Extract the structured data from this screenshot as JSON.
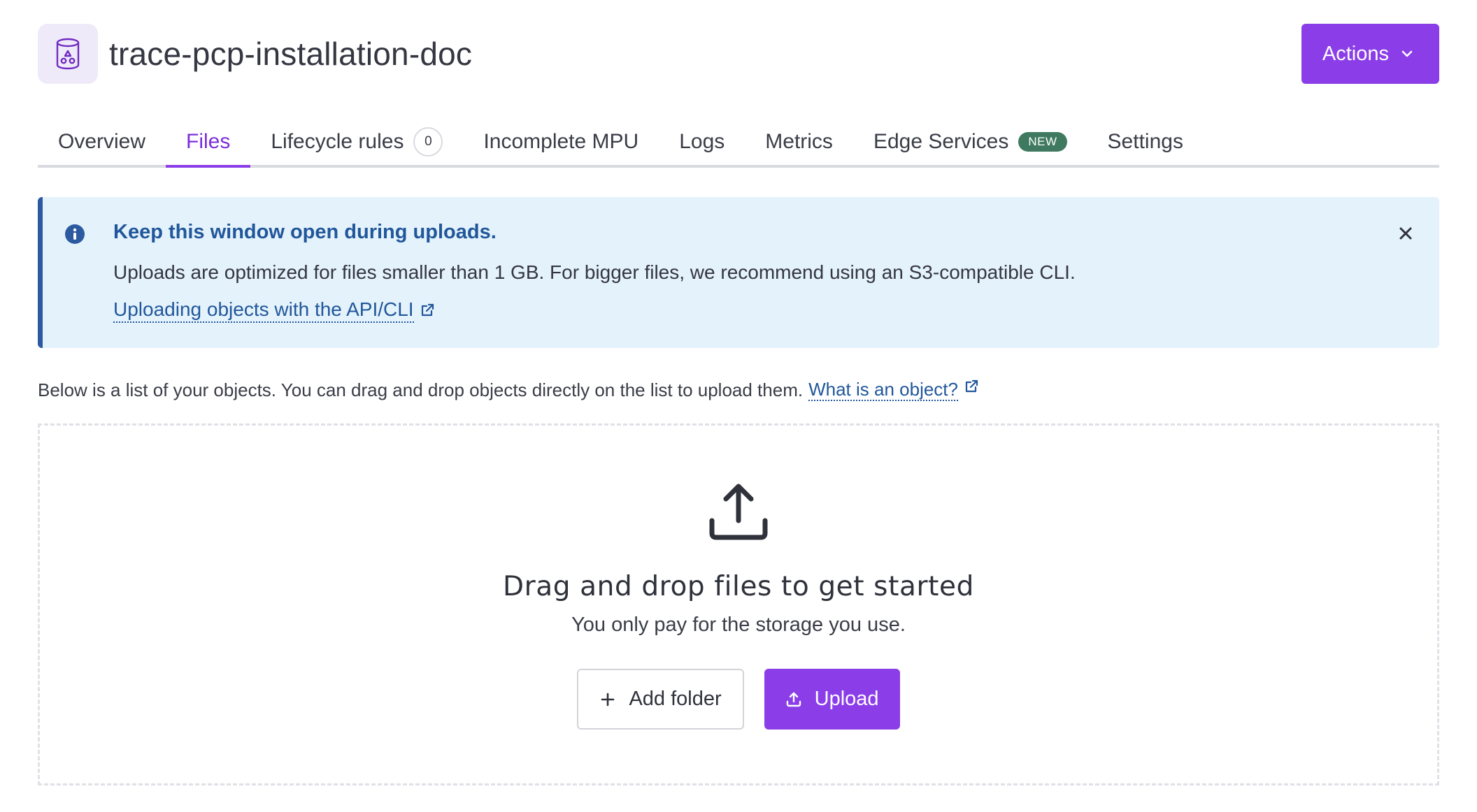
{
  "header": {
    "title": "trace-pcp-installation-doc",
    "actions_label": "Actions"
  },
  "tabs": [
    {
      "label": "Overview",
      "active": false
    },
    {
      "label": "Files",
      "active": true
    },
    {
      "label": "Lifecycle rules",
      "count": "0",
      "active": false
    },
    {
      "label": "Incomplete MPU",
      "active": false
    },
    {
      "label": "Logs",
      "active": false
    },
    {
      "label": "Metrics",
      "active": false
    },
    {
      "label": "Edge Services",
      "badge": "NEW",
      "active": false
    },
    {
      "label": "Settings",
      "active": false
    }
  ],
  "alert": {
    "title": "Keep this window open during uploads.",
    "text": "Uploads are optimized for files smaller than 1 GB. For bigger files, we recommend using an S3-compatible CLI.",
    "link_label": "Uploading objects with the API/CLI"
  },
  "description": {
    "text": "Below is a list of your objects. You can drag and drop objects directly on the list to upload them.",
    "link_label": "What is an object?"
  },
  "dropzone": {
    "title": "Drag and drop files to get started",
    "subtitle": "You only pay for the storage you use.",
    "add_folder_label": "Add folder",
    "upload_label": "Upload"
  },
  "colors": {
    "accent": "#8b3ee8",
    "info_border": "#2c5aa0",
    "info_background": "#e4f2fc",
    "new_badge": "#3f7a60"
  },
  "icons": {
    "bucket": "bucket-icon",
    "actions": "chevron-down-icon",
    "alert": "info-icon",
    "close": "close-icon",
    "external": "external-link-icon",
    "dropzone": "upload-icon",
    "add_folder": "plus-icon"
  }
}
